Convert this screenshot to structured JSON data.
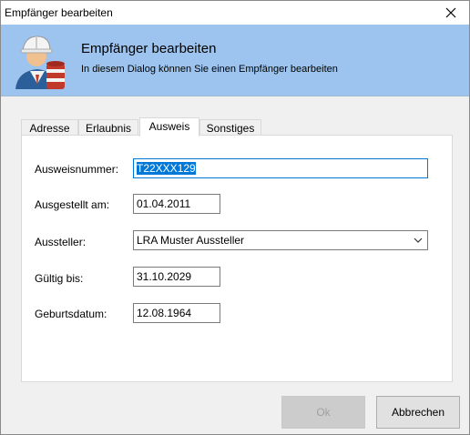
{
  "window": {
    "title": "Empfänger bearbeiten",
    "close_icon": "close-icon"
  },
  "header": {
    "title": "Empfänger bearbeiten",
    "subtitle": "In diesem Dialog können Sie einen Empfänger bearbeiten",
    "background_color": "#9cc4ef",
    "icon": "worker-hardhat-icon"
  },
  "tabs": [
    {
      "label": "Adresse",
      "active": false
    },
    {
      "label": "Erlaubnis",
      "active": false
    },
    {
      "label": "Ausweis",
      "active": true
    },
    {
      "label": "Sonstiges",
      "active": false
    }
  ],
  "form": {
    "ausweisnummer": {
      "label": "Ausweisnummer:",
      "value": "T22XXX129"
    },
    "ausgestellt": {
      "label": "Ausgestellt am:",
      "value": "01.04.2011"
    },
    "aussteller": {
      "label": "Aussteller:",
      "value": "LRA Muster Aussteller"
    },
    "gueltig": {
      "label": "Gültig bis:",
      "value": "31.10.2029"
    },
    "geburtsdatum": {
      "label": "Geburtsdatum:",
      "value": "12.08.1964"
    }
  },
  "buttons": {
    "ok": "Ok",
    "cancel": "Abbrechen"
  },
  "colors": {
    "accent": "#0078d7"
  }
}
